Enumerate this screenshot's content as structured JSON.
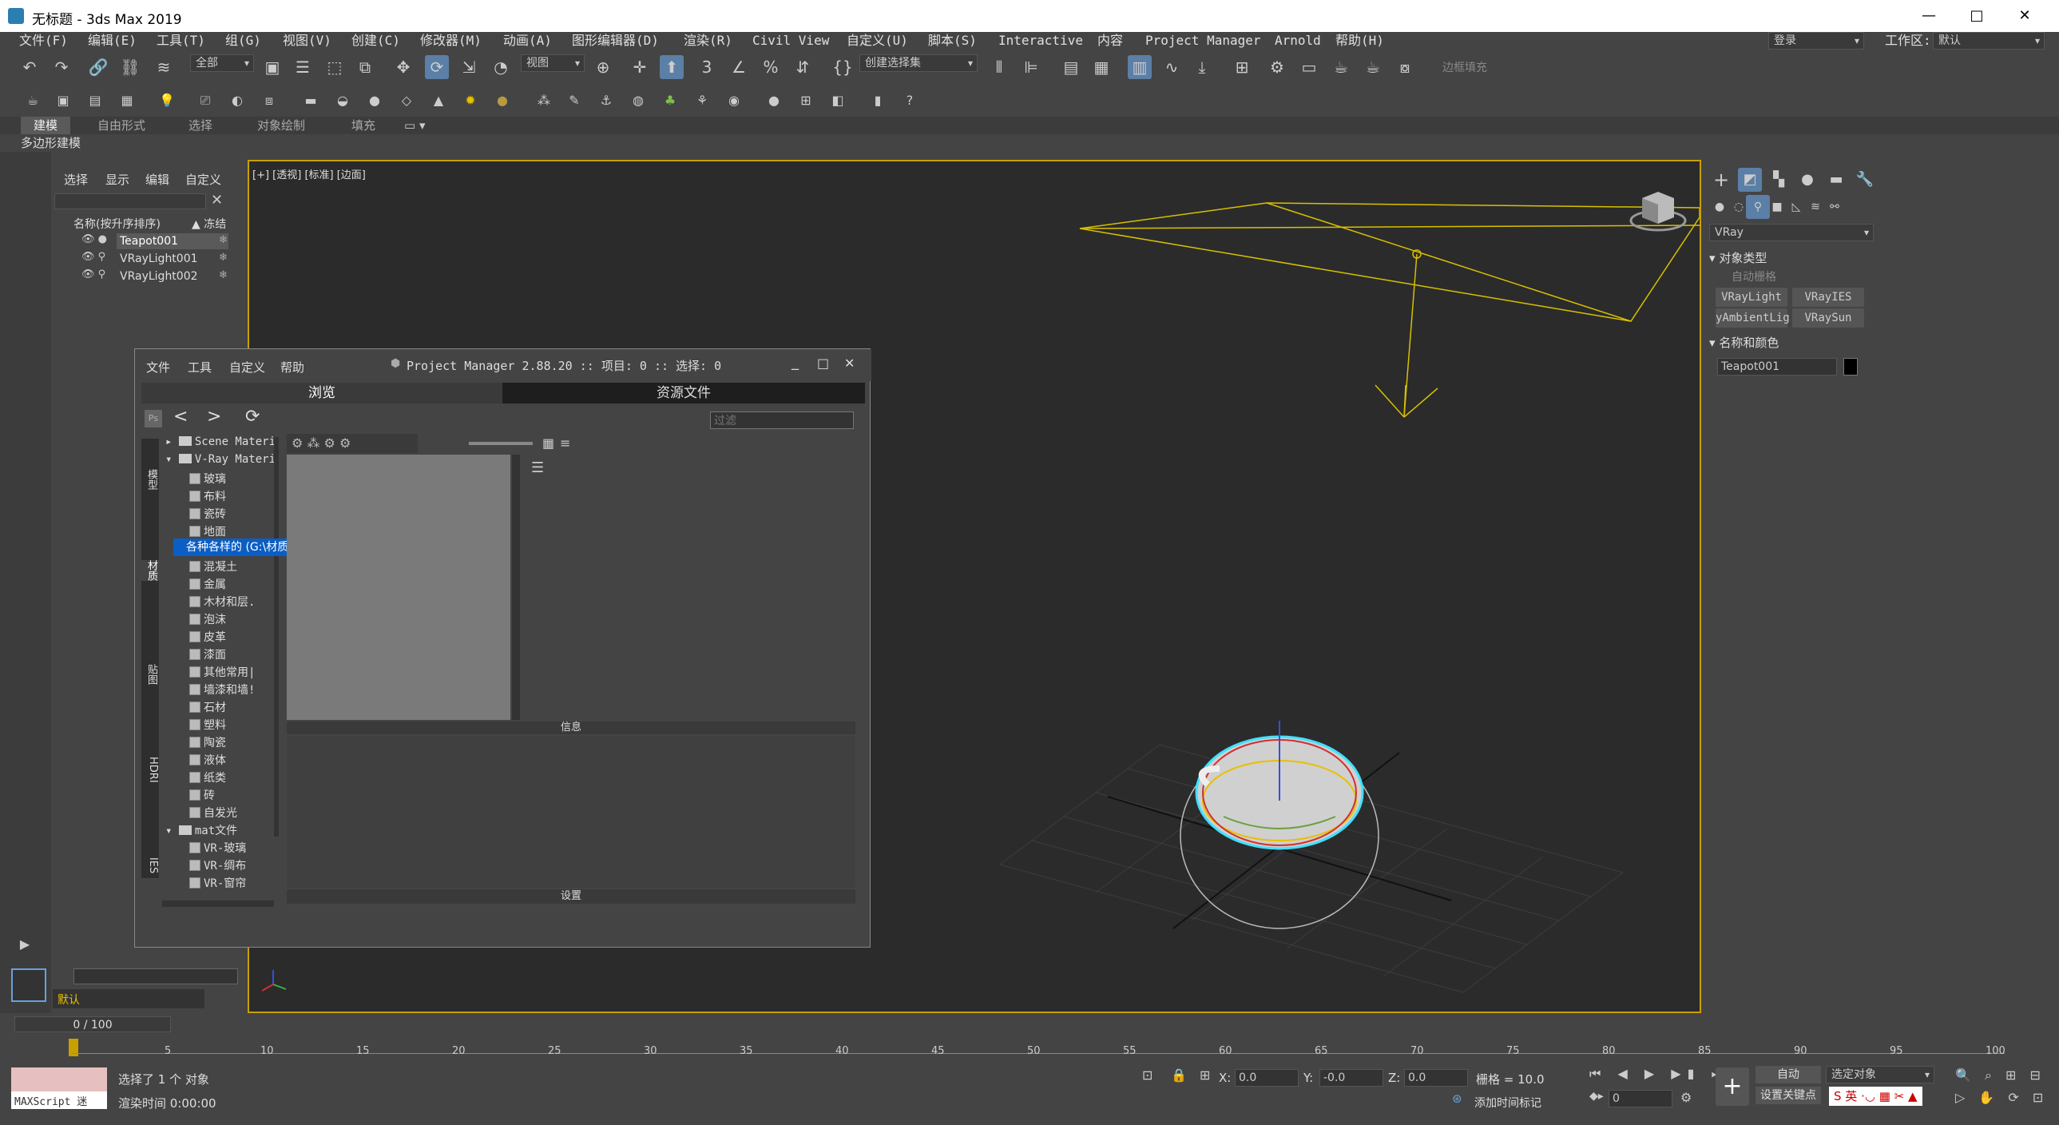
{
  "window": {
    "title": "无标题 - 3ds Max 2019",
    "minimize": "—",
    "maximize": "□",
    "close": "✕"
  },
  "menu": [
    "文件(F)",
    "编辑(E)",
    "工具(T)",
    "组(G)",
    "视图(V)",
    "创建(C)",
    "修改器(M)",
    "动画(A)",
    "图形编辑器(D)",
    "渲染(R)",
    "Civil View",
    "自定义(U)",
    "脚本(S)",
    "Interactive",
    "内容",
    "Project Manager",
    "Arnold",
    "帮助(H)"
  ],
  "account": {
    "login": "登录",
    "workspace_label": "工作区:",
    "workspace_value": "默认"
  },
  "toolbar": {
    "filter": "全部",
    "view": "视图",
    "selection_set": "创建选择集",
    "edge_fill": "边框填充"
  },
  "ribbon": {
    "tabs": [
      "建模",
      "自由形式",
      "选择",
      "对象绘制",
      "填充"
    ],
    "sub": "多边形建模"
  },
  "scene_explorer": {
    "menu": [
      "选择",
      "显示",
      "编辑",
      "自定义"
    ],
    "col_name": "名称(按升序排序)",
    "col_freeze": "▲ 冻结",
    "items": [
      "Teapot001",
      "VRayLight001",
      "VRayLight002"
    ],
    "layer": "默认"
  },
  "viewport": {
    "label": "[+] [透视] [标准] [边面]"
  },
  "command_panel": {
    "category": "VRay",
    "rollout_object_type": "对象类型",
    "auto_grid": "自动栅格",
    "buttons": [
      "VRayLight",
      "VRayIES",
      "yAmbientLig",
      "VRaySun"
    ],
    "rollout_name_color": "名称和颜色",
    "object_name": "Teapot001"
  },
  "project_manager": {
    "menu": [
      "文件",
      "工具",
      "自定义",
      "帮助"
    ],
    "title": "Project Manager 2.88.20  :: 项目: 0  :: 选择: 0",
    "tabs": [
      "浏览",
      "资源文件"
    ],
    "filter_placeholder": "过滤",
    "side_tabs": [
      "模型",
      "材质",
      "贴图",
      "HDRI",
      "IES"
    ],
    "tree": [
      {
        "type": "folder",
        "label": "Scene Materi",
        "level": 0
      },
      {
        "type": "folder",
        "label": "V-Ray Materi",
        "level": 0
      },
      {
        "type": "file",
        "label": "玻璃",
        "level": 1
      },
      {
        "type": "file",
        "label": "布料",
        "level": 1
      },
      {
        "type": "file",
        "label": "瓷砖",
        "level": 1
      },
      {
        "type": "file",
        "label": "地面",
        "level": 1
      },
      {
        "type": "file",
        "label": "各种各样的",
        "level": 1
      },
      {
        "type": "file",
        "label": "混凝土",
        "level": 1
      },
      {
        "type": "file",
        "label": "金属",
        "level": 1
      },
      {
        "type": "file",
        "label": "木材和层.",
        "level": 1
      },
      {
        "type": "file",
        "label": "泡沫",
        "level": 1
      },
      {
        "type": "file",
        "label": "皮革",
        "level": 1
      },
      {
        "type": "file",
        "label": "漆面",
        "level": 1
      },
      {
        "type": "file",
        "label": "其他常用|",
        "level": 1
      },
      {
        "type": "file",
        "label": "墙漆和墙!",
        "level": 1
      },
      {
        "type": "file",
        "label": "石材",
        "level": 1
      },
      {
        "type": "file",
        "label": "塑料",
        "level": 1
      },
      {
        "type": "file",
        "label": "陶瓷",
        "level": 1
      },
      {
        "type": "file",
        "label": "液体",
        "level": 1
      },
      {
        "type": "file",
        "label": "纸类",
        "level": 1
      },
      {
        "type": "file",
        "label": "砖",
        "level": 1
      },
      {
        "type": "file",
        "label": "自发光",
        "level": 1
      },
      {
        "type": "folder",
        "label": "mat文件",
        "level": 0
      },
      {
        "type": "file",
        "label": "VR-玻璃",
        "level": 1
      },
      {
        "type": "file",
        "label": "VR-绸布",
        "level": 1
      },
      {
        "type": "file",
        "label": "VR-窗帘",
        "level": 1
      }
    ],
    "tooltip": "各种各样的  (G:\\材质\\V-Ray Material Library\\各种各样的.mat)",
    "info": "信息",
    "settings": "设置"
  },
  "timeline": {
    "frame": "0 / 100",
    "ticks": [
      "5",
      "10",
      "15",
      "20",
      "25",
      "30",
      "35",
      "40",
      "45",
      "50",
      "55",
      "60",
      "65",
      "70",
      "75",
      "80",
      "85",
      "90",
      "95",
      "100"
    ]
  },
  "status": {
    "maxscript": "MAXScript 迷",
    "selected": "选择了 1 个 对象",
    "render_time": "渲染时间  0:00:00",
    "x_label": "X:",
    "x_value": "0.0",
    "y_label": "Y:",
    "y_value": "-0.0",
    "z_label": "Z:",
    "z_value": "0.0",
    "grid": "栅格 = 10.0",
    "add_time_tag": "添加时间标记",
    "auto": "自动",
    "selected_object": "选定对象",
    "set_key": "设置关键点",
    "spinner": "0",
    "ime": "英"
  }
}
